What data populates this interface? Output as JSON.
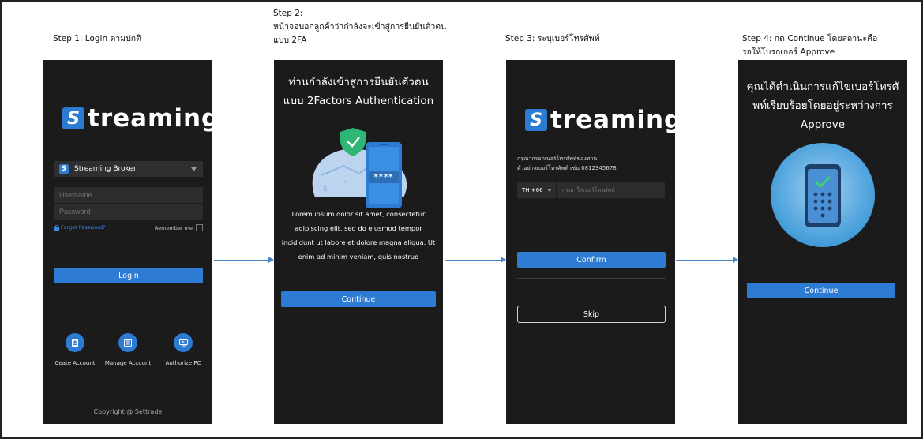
{
  "steps": [
    {
      "title": "Step 1: Login ตามปกติ"
    },
    {
      "title": "Step 2:\nหน้าจอบอกลูกค้าว่ากำลังจะเข้าสู่การยืนยันตัวตนแบบ 2FA"
    },
    {
      "title": "Step 3: ระบุเบอร์โทรศัพท์"
    },
    {
      "title": "Step 4:  กด Continue โดยสถานะคือ\nรอให้โบรกเกอร์ Approve"
    }
  ],
  "screen1": {
    "logo_letter": "S",
    "logo_text": "treaming",
    "broker_select": "Streaming Broker",
    "username_placeholder": "Username",
    "password_placeholder": "Password",
    "forget_password": "Forget Password?",
    "remember_me": "Remember me",
    "login_button": "Login",
    "actions": [
      {
        "label": "Ceate Account",
        "icon": "id-card-icon"
      },
      {
        "label": "Manage Account",
        "icon": "list-icon"
      },
      {
        "label": "Authorize PC",
        "icon": "monitor-icon"
      }
    ],
    "copyright": "Copyright @ Settrade"
  },
  "screen2": {
    "heading_line1": "ท่านกำลังเข้าสู่การยืนยันตัวตน",
    "heading_line2": "แบบ 2Factors Authentication",
    "phone_pin": "****",
    "body_lines": [
      "Lorem ipsum dolor sit amet, consectetur",
      "adipiscing elit, sed do eiusmod tempor",
      "incididunt ut labore et dolore magna aliqua. Ut",
      "enim ad minim veniam, quis nostrud"
    ],
    "continue_button": "Continue"
  },
  "screen3": {
    "logo_letter": "S",
    "logo_text": "treaming",
    "instruction_line1": "กรุณากรอกเบอร์โทรศัพท์ของท่าน",
    "instruction_line2": "ตัวอย่างเบอร์โทรศัพท์ เช่น 0812345678",
    "country_code": "TH +66",
    "phone_placeholder": "กรุณาใส่เบอร์โทรศัพท์",
    "confirm_button": "Confirm",
    "skip_button": "Skip"
  },
  "screen4": {
    "heading_lines": [
      "คุณได้ดำเนินการแก้ไขเบอร์โทรศั",
      "พท์เรียบร้อยโดยอยู่ระหว่างการ",
      "Approve"
    ],
    "continue_button": "Continue"
  },
  "colors": {
    "accent": "#2d7bd3",
    "screen_bg": "#1b1b1c",
    "arrow": "#4a86c8"
  }
}
